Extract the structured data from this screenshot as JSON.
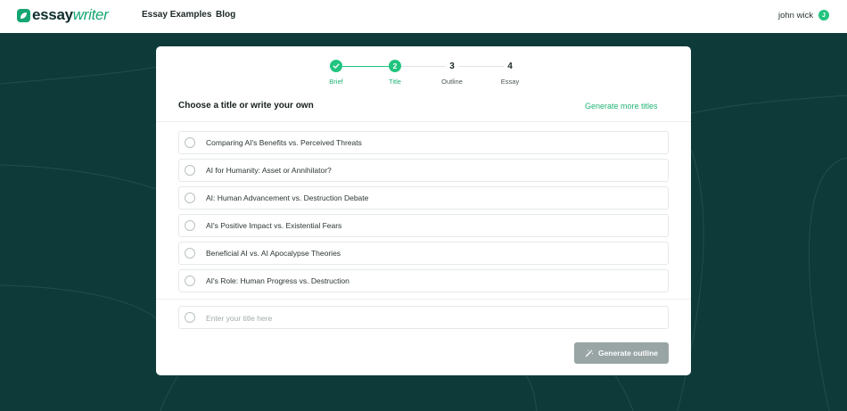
{
  "brand": {
    "name_part1": "essay",
    "name_part2": "writer",
    "accent": "#22c47f",
    "dark": "#0e3a3a"
  },
  "nav": {
    "links": [
      "Essay Examples",
      "Blog"
    ]
  },
  "user": {
    "name": "john wick",
    "initial": "J"
  },
  "stepper": {
    "steps": [
      {
        "number": "1",
        "label": "Brief",
        "state": "done",
        "icon": "check-icon"
      },
      {
        "number": "2",
        "label": "Title",
        "state": "active"
      },
      {
        "number": "3",
        "label": "Outline",
        "state": "pending"
      },
      {
        "number": "4",
        "label": "Essay",
        "state": "pending"
      }
    ]
  },
  "card": {
    "title": "Choose a title or write your own",
    "generate_more": "Generate more titles",
    "options": [
      "Comparing AI's Benefits vs. Perceived Threats",
      "AI for Humanity: Asset or Annihilator?",
      "AI: Human Advancement vs. Destruction Debate",
      "AI's Positive Impact vs. Existential Fears",
      "Beneficial AI vs. AI Apocalypse Theories",
      "AI's Role: Human Progress vs. Destruction"
    ],
    "custom_input": {
      "value": "",
      "placeholder": "Enter your title here"
    },
    "generate_outline": "Generate outline",
    "generate_outline_icon": "magic-wand-icon"
  }
}
